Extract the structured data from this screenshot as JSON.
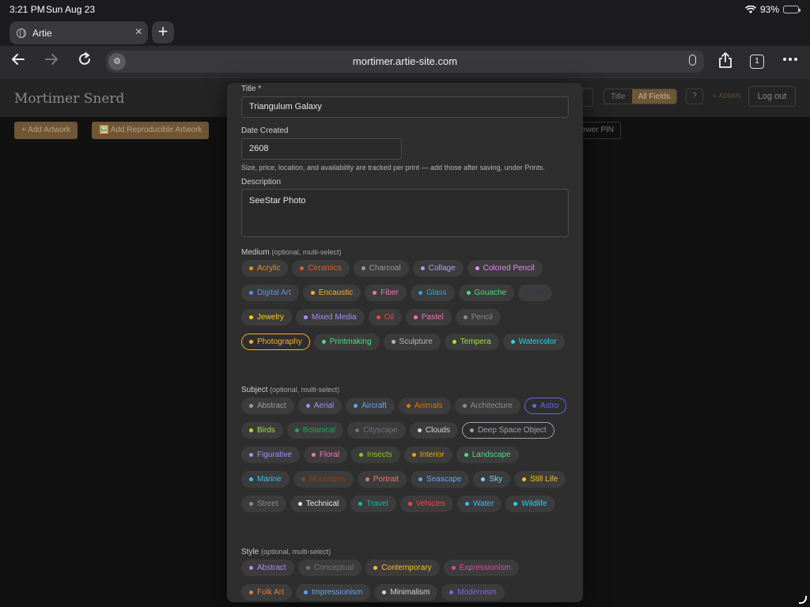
{
  "status": {
    "time": "3:21 PM",
    "date": "Sun Aug 23",
    "battery": "93%"
  },
  "browser": {
    "tab_title": "Artie",
    "url": "mortimer.artie-site.com",
    "tab_count": "1"
  },
  "app": {
    "brand": "Mortimer Snerd",
    "search_mode": [
      "Title",
      "All Fields"
    ],
    "help_label": "?",
    "admin_label": "+ ADMIN",
    "logout_label": "Log out",
    "add_artwork": "+ Add Artwork",
    "add_reproducible": "🖼️ Add Reproducible Artwork",
    "viewer_pin": "ewer PIN"
  },
  "form": {
    "title_label": "Title *",
    "title_value": "Triangulum Galaxy",
    "date_label": "Date Created",
    "date_value": "2608",
    "hint": "Size, price, location, and availability are tracked per print — add those after saving, under Prints.",
    "description_label": "Description",
    "description_value": "SeeStar Photo",
    "optional_text": "(optional, multi-select)",
    "medium_label": "Medium",
    "subject_label": "Subject",
    "style_label": "Style"
  },
  "medium_chips": [
    {
      "label": "Acrylic",
      "color": "#f08a24"
    },
    {
      "label": "Ceramics",
      "color": "#d9622b"
    },
    {
      "label": "Charcoal",
      "color": "#9a9a9a"
    },
    {
      "label": "Collage",
      "color": "#b39dfb"
    },
    {
      "label": "Colored Pencil",
      "color": "#e38cf5"
    },
    {
      "label": "Digital Art",
      "color": "#5b8ef5"
    },
    {
      "label": "Encaustic",
      "color": "#f5b027"
    },
    {
      "label": "Fiber",
      "color": "#f472b6"
    },
    {
      "label": "Glass",
      "color": "#29a8cc"
    },
    {
      "label": "Gouache",
      "color": "#4ade80"
    },
    {
      "label": "Ink",
      "color": "#2d3a5a"
    },
    {
      "label": "Jewelry",
      "color": "#facc15"
    },
    {
      "label": "Mixed Media",
      "color": "#a78bfa"
    },
    {
      "label": "Oil",
      "color": "#ef4444"
    },
    {
      "label": "Pastel",
      "color": "#f472b6"
    },
    {
      "label": "Pencil",
      "color": "#8a8a8a"
    },
    {
      "label": "Photography",
      "color": "#f5b027",
      "selected": true
    },
    {
      "label": "Printmaking",
      "color": "#4ade80"
    },
    {
      "label": "Sculpture",
      "color": "#b5b5b5"
    },
    {
      "label": "Tempera",
      "color": "#a3e635"
    },
    {
      "label": "Watercolor",
      "color": "#22d3ee"
    }
  ],
  "subject_chips": [
    {
      "label": "Abstract",
      "color": "#9a9a9a"
    },
    {
      "label": "Aerial",
      "color": "#a78bfa"
    },
    {
      "label": "Aircraft",
      "color": "#60a5fa"
    },
    {
      "label": "Animals",
      "color": "#d97706"
    },
    {
      "label": "Architecture",
      "color": "#8f8f8f"
    },
    {
      "label": "Astro",
      "color": "#6366f1",
      "selected": true
    },
    {
      "label": "Birds",
      "color": "#a3e635"
    },
    {
      "label": "Botanical",
      "color": "#22a35a"
    },
    {
      "label": "Cityscape",
      "color": "#6b7280"
    },
    {
      "label": "Clouds",
      "color": "#cbd5e1"
    },
    {
      "label": "Deep Space Object",
      "color": "#9ca3af",
      "selected": true
    },
    {
      "label": "Figurative",
      "color": "#a78bfa"
    },
    {
      "label": "Floral",
      "color": "#f472b6"
    },
    {
      "label": "Insects",
      "color": "#84cc16"
    },
    {
      "label": "Interior",
      "color": "#f59e0b"
    },
    {
      "label": "Landscape",
      "color": "#4ade80"
    },
    {
      "label": "Marine",
      "color": "#38bdf8"
    },
    {
      "label": "Mountains",
      "color": "#92400e"
    },
    {
      "label": "Portrait",
      "color": "#f87171"
    },
    {
      "label": "Seascape",
      "color": "#60a5fa"
    },
    {
      "label": "Sky",
      "color": "#7dd3fc"
    },
    {
      "label": "Still Life",
      "color": "#fbbf24"
    },
    {
      "label": "Street",
      "color": "#8a8a8a"
    },
    {
      "label": "Technical",
      "color": "#e5e7eb"
    },
    {
      "label": "Travel",
      "color": "#14b8a6"
    },
    {
      "label": "Vehicles",
      "color": "#ef4444"
    },
    {
      "label": "Water",
      "color": "#38bdf8"
    },
    {
      "label": "Wildlife",
      "color": "#22d3ee"
    }
  ],
  "style_chips": [
    {
      "label": "Abstract",
      "color": "#a78bfa"
    },
    {
      "label": "Conceptual",
      "color": "#6b7280"
    },
    {
      "label": "Contemporary",
      "color": "#fbbf24"
    },
    {
      "label": "Expressionism",
      "color": "#ec4899"
    },
    {
      "label": "Folk Art",
      "color": "#ea7a2b"
    },
    {
      "label": "Impressionism",
      "color": "#60a5fa"
    },
    {
      "label": "Minimalism",
      "color": "#d1d5db"
    },
    {
      "label": "Modernism",
      "color": "#8b5cf6"
    }
  ]
}
